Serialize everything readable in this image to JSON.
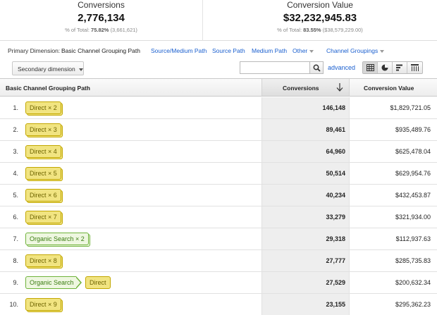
{
  "summary": {
    "conversions": {
      "label": "Conversions",
      "value": "2,776,134",
      "pct_prefix": "% of Total: ",
      "pct": "75.82%",
      "total": "(3,661,621)"
    },
    "conversion_value": {
      "label": "Conversion Value",
      "value": "$32,232,945.83",
      "pct_prefix": "% of Total: ",
      "pct": "83.55%",
      "total": "($38,579,229.00)"
    }
  },
  "dimension_bar": {
    "label": "Primary Dimension:",
    "active": "Basic Channel Grouping Path",
    "links": [
      "Source/Medium Path",
      "Source Path",
      "Medium Path"
    ],
    "other": "Other",
    "channel_groupings": "Channel Groupings"
  },
  "toolbar": {
    "secondary_dimension": "Secondary dimension",
    "search_value": "",
    "advanced": "advanced"
  },
  "table": {
    "headers": {
      "path": "Basic Channel Grouping Path",
      "conversions": "Conversions",
      "value": "Conversion Value"
    },
    "rows": [
      {
        "index": "1.",
        "chips": [
          {
            "type": "direct",
            "label": "Direct × 2"
          }
        ],
        "conversions": "146,148",
        "value": "$1,829,721.05"
      },
      {
        "index": "2.",
        "chips": [
          {
            "type": "direct",
            "label": "Direct × 3"
          }
        ],
        "conversions": "89,461",
        "value": "$935,489.76"
      },
      {
        "index": "3.",
        "chips": [
          {
            "type": "direct",
            "label": "Direct × 4"
          }
        ],
        "conversions": "64,960",
        "value": "$625,478.04"
      },
      {
        "index": "4.",
        "chips": [
          {
            "type": "direct",
            "label": "Direct × 5"
          }
        ],
        "conversions": "50,514",
        "value": "$629,954.76"
      },
      {
        "index": "5.",
        "chips": [
          {
            "type": "direct",
            "label": "Direct × 6"
          }
        ],
        "conversions": "40,234",
        "value": "$432,453.87"
      },
      {
        "index": "6.",
        "chips": [
          {
            "type": "direct",
            "label": "Direct × 7"
          }
        ],
        "conversions": "33,279",
        "value": "$321,934.00"
      },
      {
        "index": "7.",
        "chips": [
          {
            "type": "organic",
            "label": "Organic Search × 2"
          }
        ],
        "conversions": "29,318",
        "value": "$112,937.63"
      },
      {
        "index": "8.",
        "chips": [
          {
            "type": "direct",
            "label": "Direct × 8"
          }
        ],
        "conversions": "27,777",
        "value": "$285,735.83"
      },
      {
        "index": "9.",
        "chips": [
          {
            "type": "organic",
            "label": "Organic Search"
          },
          {
            "type": "direct",
            "label": "Direct"
          }
        ],
        "conversions": "27,529",
        "value": "$200,632.34"
      },
      {
        "index": "10.",
        "chips": [
          {
            "type": "direct",
            "label": "Direct × 9"
          }
        ],
        "conversions": "23,155",
        "value": "$295,362.23"
      }
    ]
  },
  "colors": {
    "link": "#1a5fcf",
    "direct_fill": "#f1e481",
    "direct_border": "#c2a700",
    "organic_fill": "#eef7e0",
    "organic_border": "#6fb33b",
    "sorted_column": "#eeeeee"
  },
  "icons": [
    "search-icon",
    "sort-down-arrow-icon",
    "table-view-icon",
    "pie-view-icon",
    "performance-view-icon",
    "pivot-view-icon"
  ]
}
